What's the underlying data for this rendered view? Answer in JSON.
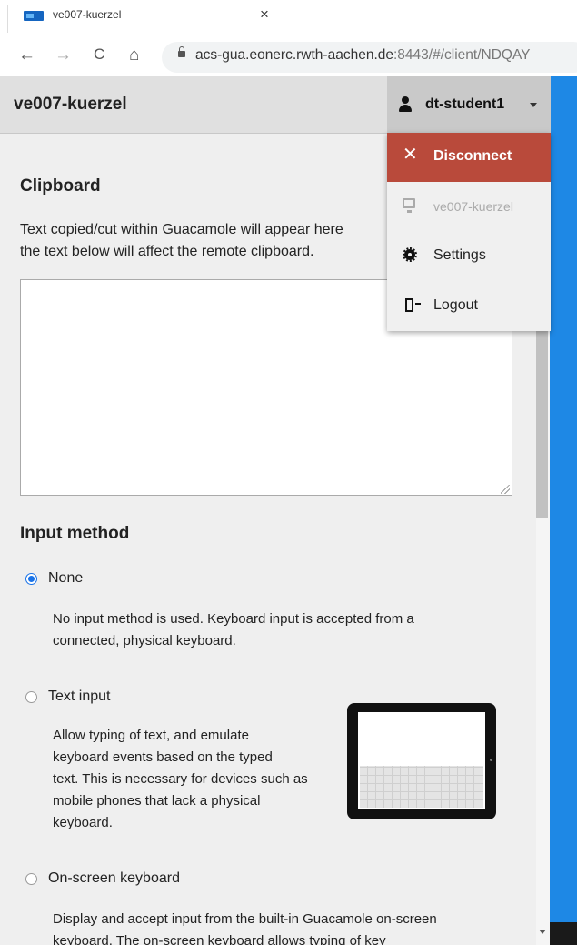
{
  "browser": {
    "tab_title": "ve007-kuerzel",
    "tab_close": "×",
    "back": "←",
    "forward": "→",
    "reload": "C",
    "home": "⌂",
    "url_host": "acs-gua.eonerc.rwth-aachen.de",
    "url_rest": ":8443/#/client/NDQAY"
  },
  "header": {
    "connection_name": "ve007-kuerzel",
    "username": "dt-student1"
  },
  "menu": {
    "disconnect": "Disconnect",
    "connection": "ve007-kuerzel",
    "settings": "Settings",
    "logout": "Logout"
  },
  "clipboard": {
    "title": "Clipboard",
    "description_line1": "Text copied/cut within Guacamole will appear here",
    "description_line2": "the text below will affect the remote clipboard.",
    "value": ""
  },
  "input_method": {
    "title": "Input method",
    "options": [
      {
        "label": "None",
        "checked": true,
        "desc": [
          "No input method is used. Keyboard input is accepted from a",
          "connected, physical keyboard."
        ]
      },
      {
        "label": "Text input",
        "checked": false,
        "desc": [
          "Allow typing of text, and emulate",
          "keyboard events based on the typed",
          "text. This is necessary for devices such as",
          "mobile phones that lack a physical",
          "keyboard."
        ]
      },
      {
        "label": "On-screen keyboard",
        "checked": false,
        "desc": [
          "Display and accept input from the built-in Guacamole on-screen",
          "keyboard. The on-screen keyboard allows typing of key"
        ]
      }
    ]
  },
  "colors": {
    "disconnect_bg": "#b94a3b",
    "accent": "#1e88e5",
    "radio_checked": "#1a73e8"
  }
}
